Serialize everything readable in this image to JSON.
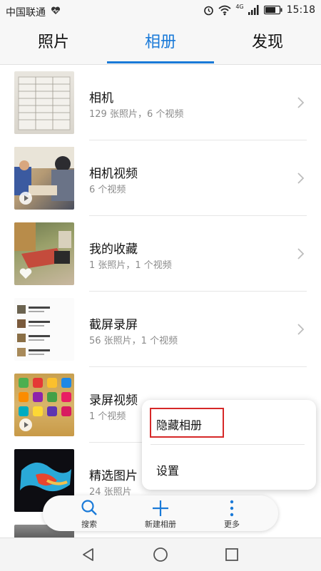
{
  "status_bar": {
    "carrier": "中国联通",
    "network": "4G",
    "time": "15:18",
    "icons": [
      "heart-rate-icon",
      "alarm-icon",
      "wifi-icon",
      "signal-icon",
      "battery-icon"
    ]
  },
  "tabs": [
    {
      "label": "照片",
      "active": false
    },
    {
      "label": "相册",
      "active": true
    },
    {
      "label": "发现",
      "active": false
    }
  ],
  "accent_color": "#1a7ad8",
  "albums": [
    {
      "name": "相机",
      "count": "129 张照片，6 个视频",
      "badge": "none"
    },
    {
      "name": "相机视频",
      "count": "6 个视频",
      "badge": "play"
    },
    {
      "name": "我的收藏",
      "count": "1 张照片，1 个视频",
      "badge": "heart"
    },
    {
      "name": "截屏录屏",
      "count": "56 张照片，1 个视频",
      "badge": "none"
    },
    {
      "name": "录屏视频",
      "count": "1 个视频",
      "badge": "play"
    },
    {
      "name": "精选图片",
      "count": "24 张照片",
      "badge": "none"
    }
  ],
  "popup_menu": {
    "items": [
      "隐藏相册",
      "设置"
    ],
    "highlight_color": "#d62828"
  },
  "toolbar": {
    "search_label": "搜索",
    "new_album_label": "新建相册",
    "more_label": "更多"
  },
  "nav_bar": {
    "icons": [
      "back-icon",
      "home-icon",
      "recents-icon"
    ]
  }
}
